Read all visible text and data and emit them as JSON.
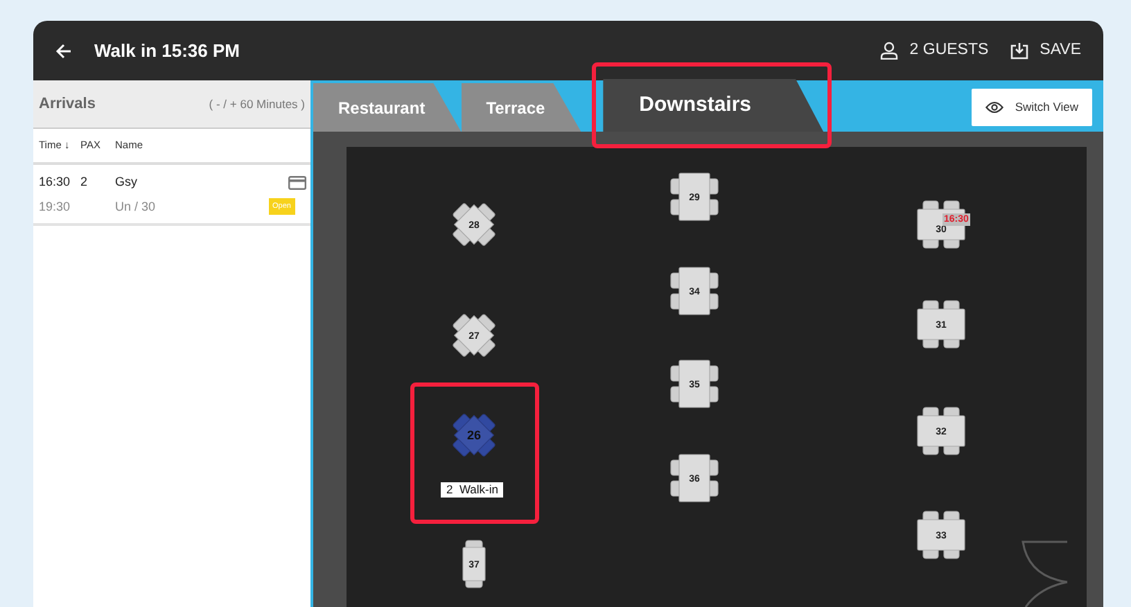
{
  "window": {
    "title": "Walk in 15:36 PM"
  },
  "header_actions": [
    {
      "kind": "guests",
      "label": "2 GUESTS"
    },
    {
      "kind": "save",
      "label": "SAVE"
    }
  ],
  "arrivals": {
    "title": "Arrivals",
    "range": "( - / + 60 Minutes )",
    "columns": [
      "Time ↓",
      "PAX",
      "Name"
    ],
    "rows": [
      {
        "time": "16:30",
        "pax": "2",
        "name": "Gsy",
        "time_2": "19:30",
        "detail": "Un / 30",
        "status": "Open"
      }
    ]
  },
  "floor": {
    "tabs": [
      {
        "label": "Restaurant",
        "selected": false,
        "highlighted": false
      },
      {
        "label": "Terrace",
        "selected": false,
        "highlighted": false
      },
      {
        "label": "Downstairs",
        "selected": true,
        "highlighted": true
      }
    ],
    "switch_view": "Switch View",
    "tables": [
      {
        "number": "28",
        "kind": "diamond",
        "selected": false,
        "highlighted": false
      },
      {
        "number": "27",
        "kind": "diamond",
        "selected": false,
        "highlighted": false
      },
      {
        "number": "26",
        "kind": "diamond",
        "selected": true,
        "highlighted": true,
        "label": "2  Walk-in"
      },
      {
        "number": "37",
        "kind": "small",
        "selected": false,
        "highlighted": false
      },
      {
        "number": "29",
        "kind": "vertical",
        "selected": false,
        "highlighted": false
      },
      {
        "number": "34",
        "kind": "vertical",
        "selected": false,
        "highlighted": false
      },
      {
        "number": "35",
        "kind": "vertical",
        "selected": false,
        "highlighted": false
      },
      {
        "number": "36",
        "kind": "vertical",
        "selected": false,
        "highlighted": false
      },
      {
        "number": "30",
        "kind": "horizontal",
        "selected": false,
        "highlighted": false,
        "time": "16:30"
      },
      {
        "number": "31",
        "kind": "horizontal",
        "selected": false,
        "highlighted": false
      },
      {
        "number": "32",
        "kind": "horizontal",
        "selected": false,
        "highlighted": false
      },
      {
        "number": "33",
        "kind": "horizontal",
        "selected": false,
        "highlighted": false
      }
    ]
  }
}
